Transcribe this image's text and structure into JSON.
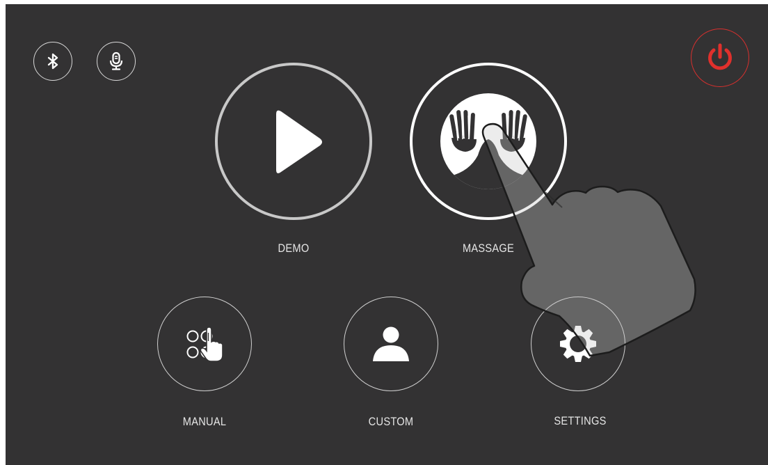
{
  "top_bar": {
    "bluetooth_icon": "bluetooth-icon",
    "microphone_icon": "microphone-icon",
    "power_icon": "power-icon",
    "power_color": "#e0302c"
  },
  "main_buttons": {
    "demo": {
      "label": "DEMO",
      "icon": "play-icon"
    },
    "massage": {
      "label": "MASSAGE",
      "icon": "massage-hands-icon"
    }
  },
  "secondary_buttons": {
    "manual": {
      "label": "MANUAL",
      "icon": "manual-touch-icon"
    },
    "custom": {
      "label": "CUSTOM",
      "icon": "user-icon"
    },
    "settings": {
      "label": "SETTINGS",
      "icon": "gear-icon"
    }
  }
}
